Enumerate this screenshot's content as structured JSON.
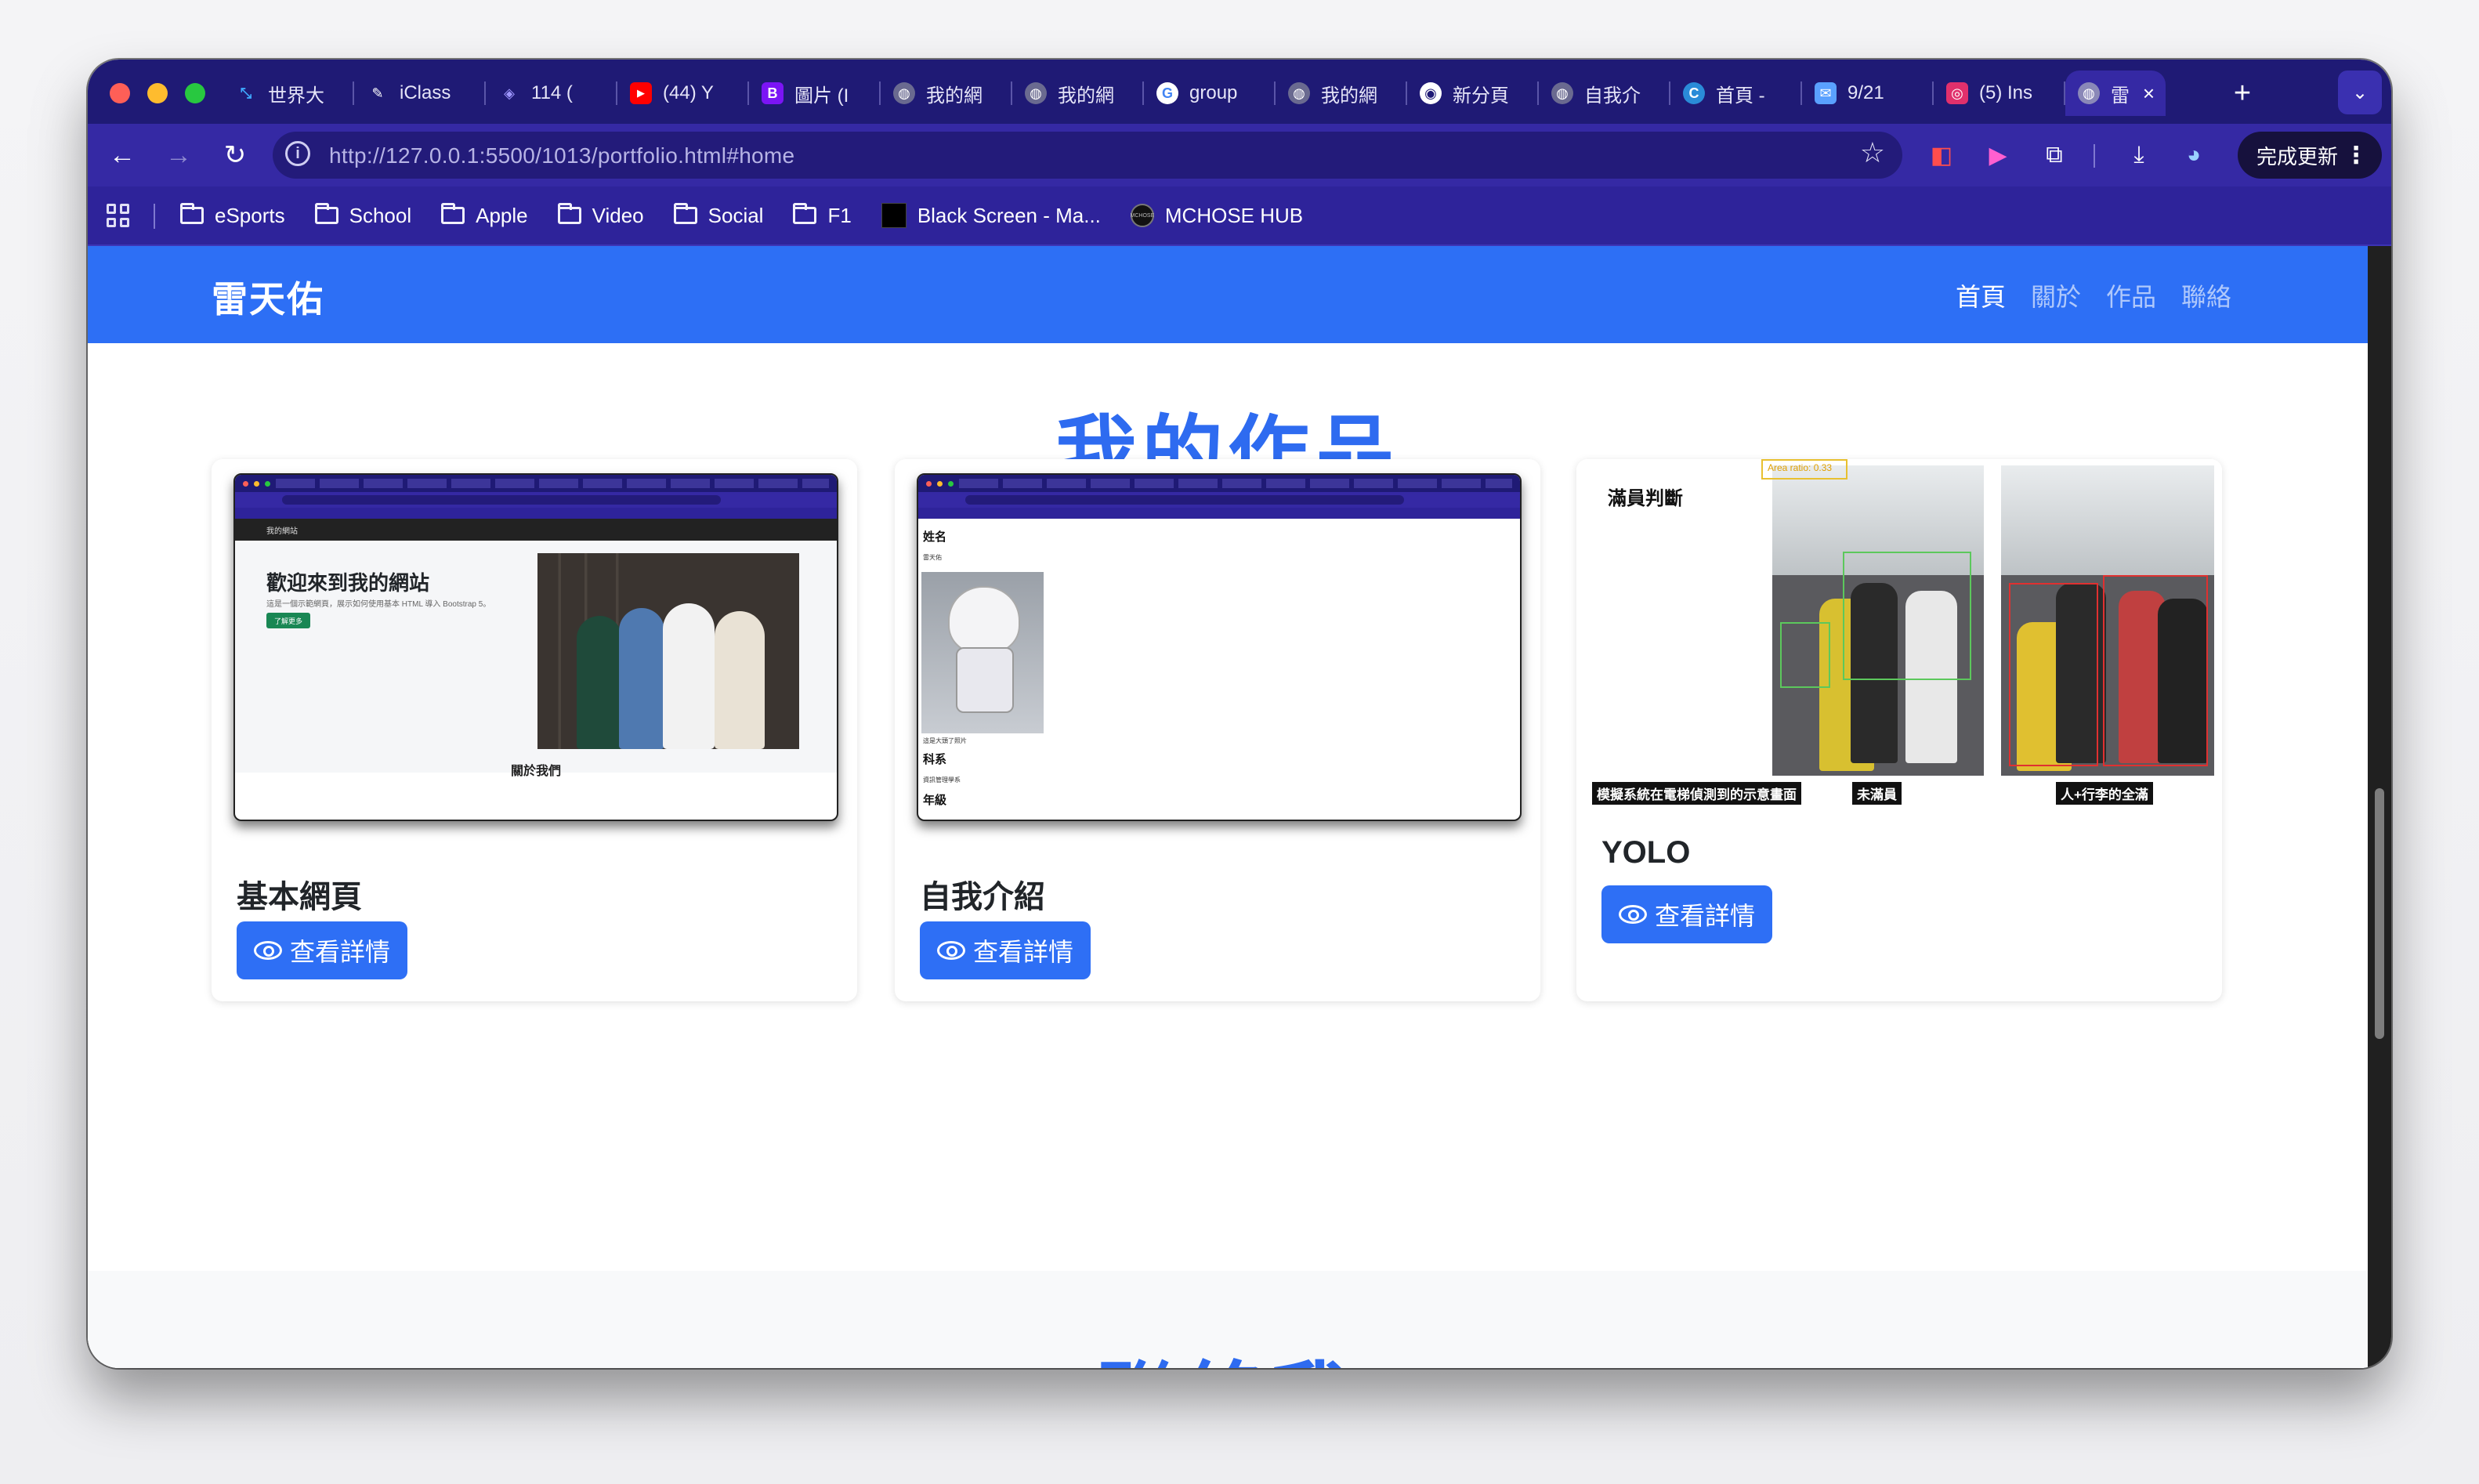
{
  "browser": {
    "tabs": [
      {
        "title": "世界大",
        "favicon": "crossed-arrows",
        "color": "#1b6fd9"
      },
      {
        "title": "iClass",
        "favicon": "pen",
        "color": "#3529a4"
      },
      {
        "title": "114 (",
        "favicon": "layers",
        "color": "#6f63d8"
      },
      {
        "title": "(44) Y",
        "favicon": "youtube",
        "color": "#ff0000"
      },
      {
        "title": "圖片 (I",
        "favicon": "bootstrap-b",
        "color": "#7b14f5"
      },
      {
        "title": "我的網",
        "favicon": "globe",
        "color": "#6a6a90"
      },
      {
        "title": "我的網",
        "favicon": "globe",
        "color": "#6a6a90"
      },
      {
        "title": "group",
        "favicon": "google-g",
        "color": "#ffffff"
      },
      {
        "title": "我的網",
        "favicon": "globe",
        "color": "#6a6a90"
      },
      {
        "title": "新分頁",
        "favicon": "chrome",
        "color": "#ffffff"
      },
      {
        "title": "自我介",
        "favicon": "globe",
        "color": "#6a6a90"
      },
      {
        "title": "首頁 -",
        "favicon": "edge-c",
        "color": "#2a8bd8"
      },
      {
        "title": "9/21 ",
        "favicon": "chat",
        "color": "#5aa0ff"
      },
      {
        "title": "(5) Ins",
        "favicon": "instagram",
        "color": "#e1306c"
      }
    ],
    "active_tab": {
      "title": "雷",
      "favicon": "globe"
    },
    "url": "http://127.0.0.1:5500/1013/portfolio.html#home",
    "update_button": "完成更新",
    "bookmarks": [
      {
        "label": "eSports",
        "icon": "folder"
      },
      {
        "label": "School",
        "icon": "folder"
      },
      {
        "label": "Apple",
        "icon": "folder"
      },
      {
        "label": "Video",
        "icon": "folder"
      },
      {
        "label": "Social",
        "icon": "folder"
      },
      {
        "label": "F1",
        "icon": "folder"
      },
      {
        "label": "Black Screen - Ma...",
        "icon": "black-square"
      },
      {
        "label": "MCHOSE HUB",
        "icon": "mchose-logo"
      }
    ],
    "bookmark_logo_text": "MCHOSE"
  },
  "site": {
    "brand": "雷天佑",
    "nav": [
      "首頁",
      "關於",
      "作品",
      "聯絡"
    ],
    "active_nav": "首頁",
    "accent": "#2d6ff5",
    "portfolio_title": "我的作品",
    "contact_title": "聯絡我",
    "cards": [
      {
        "title": "基本網頁",
        "button": "查看詳情",
        "preview": {
          "nav": "我的網站",
          "hero_title": "歡迎來到我的網站",
          "hero_sub": "這是一個示範網頁，展示如何使用基本 HTML 導入 Bootstrap 5。",
          "hero_btn": "了解更多",
          "about": "關於我們"
        }
      },
      {
        "title": "自我介紹",
        "button": "查看詳情",
        "preview": {
          "label1": "姓名",
          "small1": "雷天佑",
          "small2": "這是大頭了照片",
          "label2": "科系",
          "small3": "資訊管理學系",
          "label3": "年級"
        }
      },
      {
        "title": "YOLO",
        "button": "查看詳情",
        "preview": {
          "label": "滿員判斷",
          "ratio_text": "Area ratio: 0.33",
          "captions": [
            "模擬系統在電梯偵測到的示意畫面",
            "未滿員",
            "人+行李的全滿"
          ]
        }
      }
    ]
  }
}
